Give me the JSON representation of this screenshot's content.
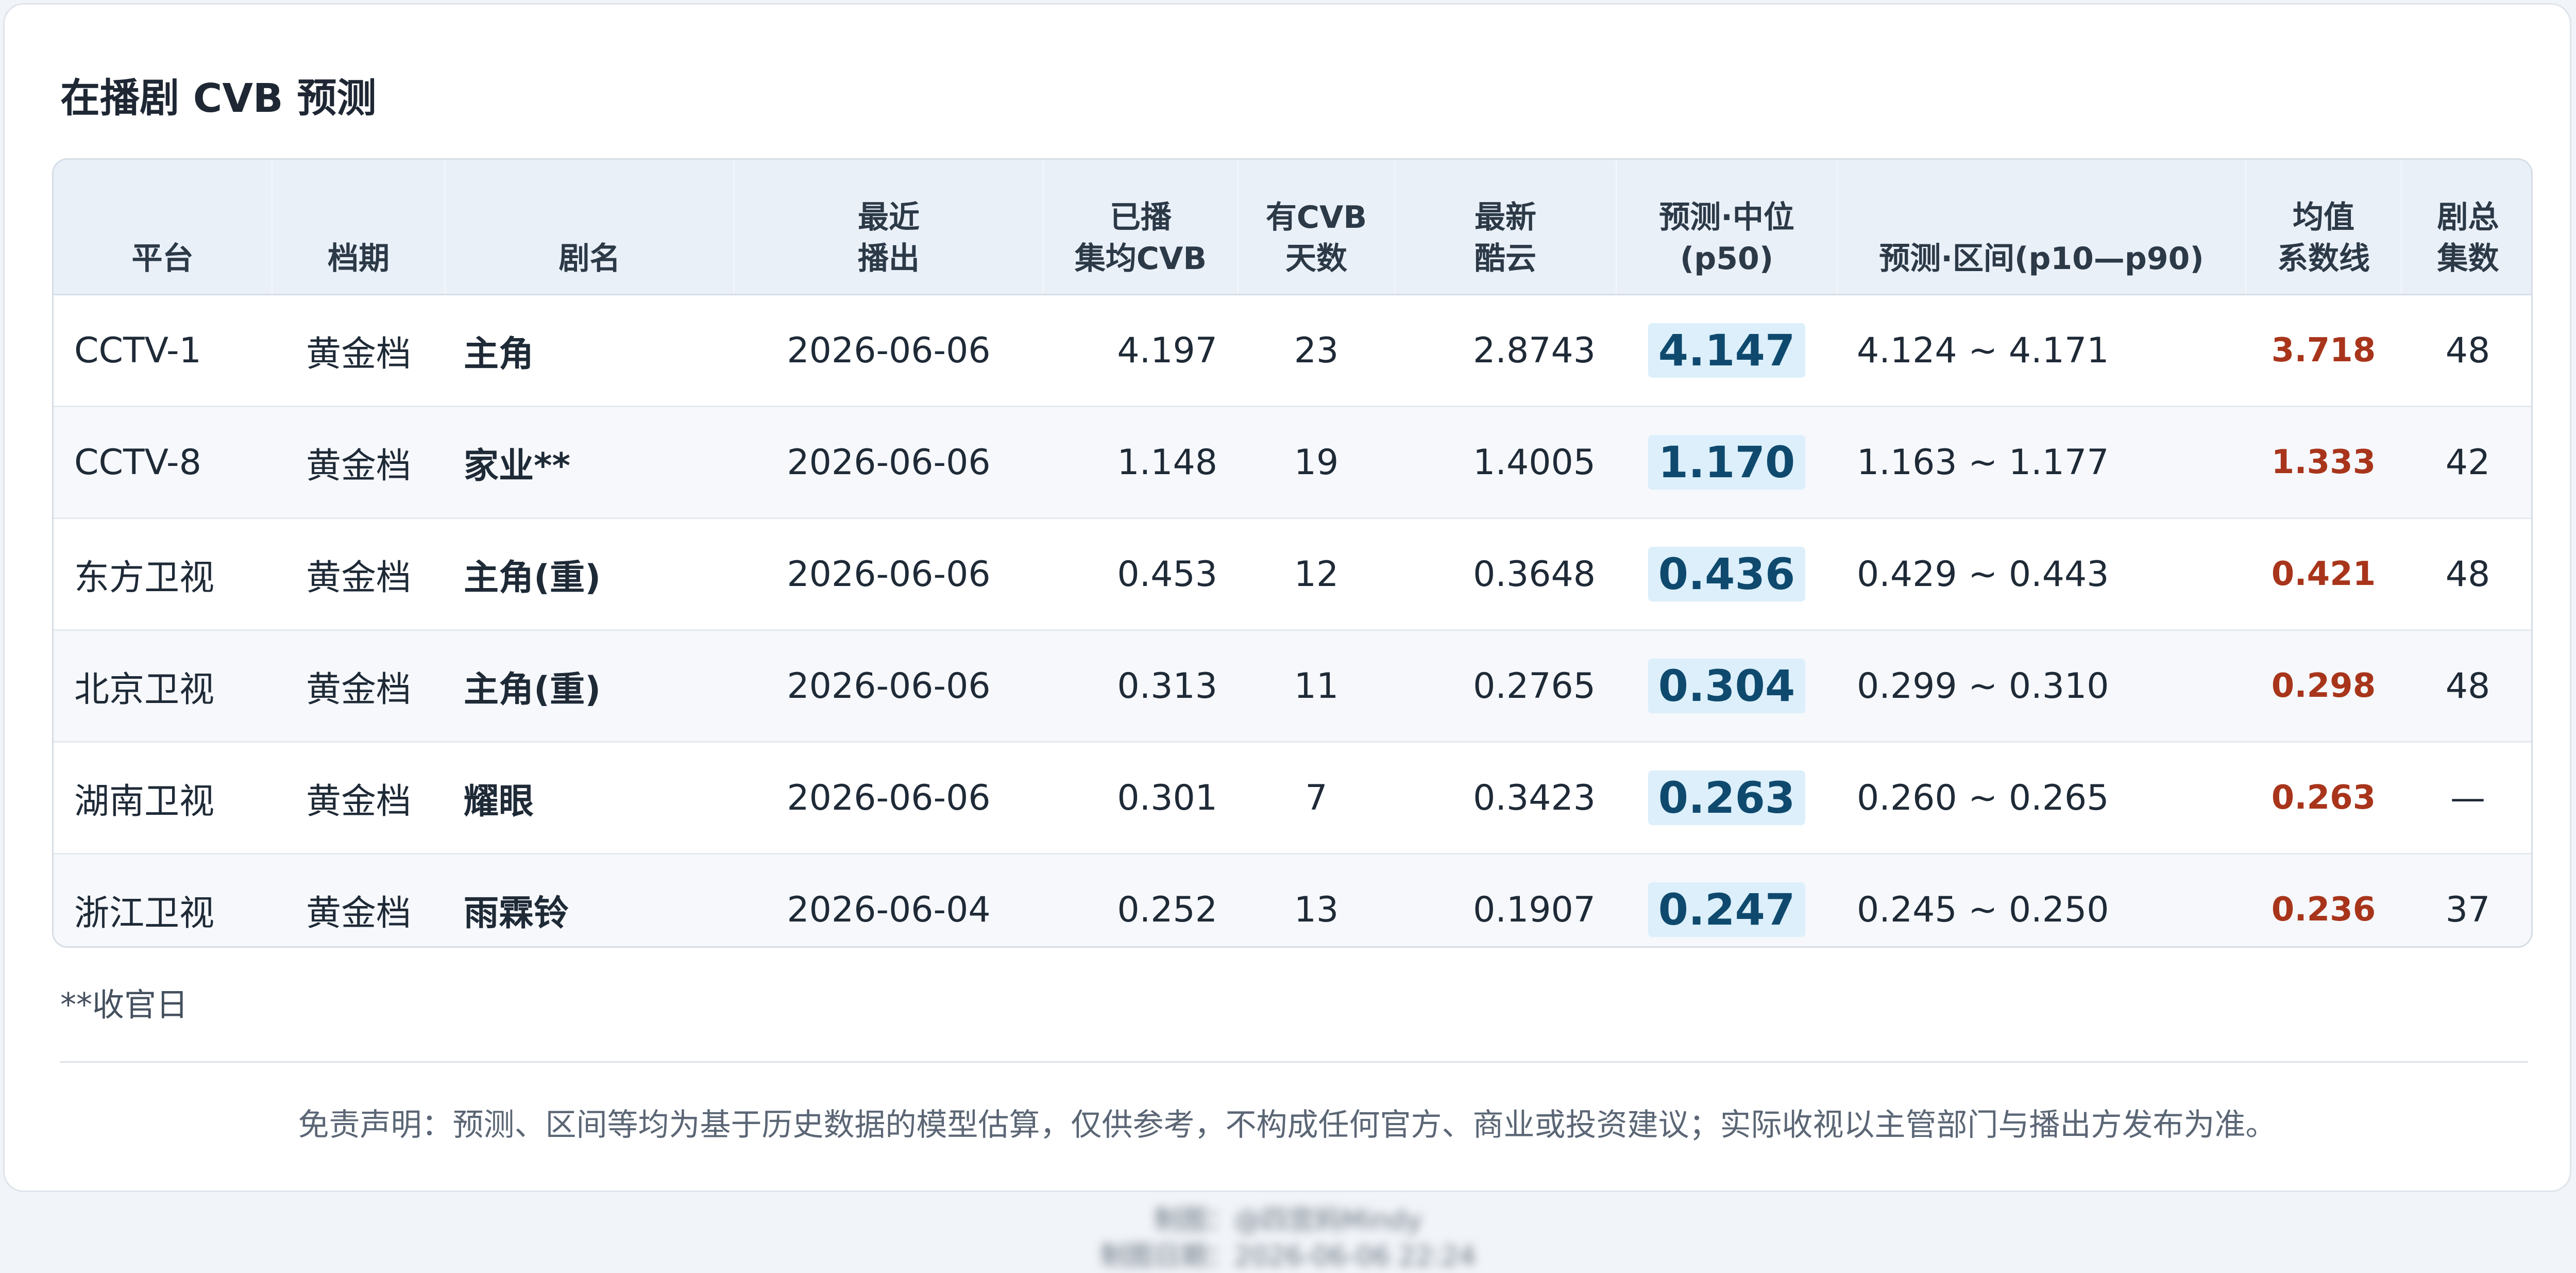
{
  "title": "在播剧 CVB 预测",
  "table": {
    "headers": {
      "platform": [
        "平台"
      ],
      "slot": [
        "档期"
      ],
      "drama": [
        "剧名"
      ],
      "recent_air": [
        "最近",
        "播出"
      ],
      "aired_avg": [
        "已播",
        "集均CVB"
      ],
      "cvb_days": [
        "有CVB",
        "天数"
      ],
      "kuyun": [
        "最新",
        "酷云"
      ],
      "p50": [
        "预测·中位",
        "(p50)"
      ],
      "range": [
        "预测·区间(p10—p90)"
      ],
      "mean_coef": [
        "均值",
        "系数线"
      ],
      "total_eps": [
        "剧总",
        "集数"
      ]
    },
    "rows": [
      {
        "platform": "CCTV-1",
        "slot": "黄金档",
        "drama": "主角",
        "recent_air": "2026-06-06",
        "aired_avg": "4.197",
        "cvb_days": "23",
        "kuyun": "2.8743",
        "p50": "4.147",
        "range": "4.124 ~ 4.171",
        "mean_coef": "3.718",
        "total_eps": "48"
      },
      {
        "platform": "CCTV-8",
        "slot": "黄金档",
        "drama": "家业**",
        "recent_air": "2026-06-06",
        "aired_avg": "1.148",
        "cvb_days": "19",
        "kuyun": "1.4005",
        "p50": "1.170",
        "range": "1.163 ~ 1.177",
        "mean_coef": "1.333",
        "total_eps": "42"
      },
      {
        "platform": "东方卫视",
        "slot": "黄金档",
        "drama": "主角(重)",
        "recent_air": "2026-06-06",
        "aired_avg": "0.453",
        "cvb_days": "12",
        "kuyun": "0.3648",
        "p50": "0.436",
        "range": "0.429 ~ 0.443",
        "mean_coef": "0.421",
        "total_eps": "48"
      },
      {
        "platform": "北京卫视",
        "slot": "黄金档",
        "drama": "主角(重)",
        "recent_air": "2026-06-06",
        "aired_avg": "0.313",
        "cvb_days": "11",
        "kuyun": "0.2765",
        "p50": "0.304",
        "range": "0.299 ~ 0.310",
        "mean_coef": "0.298",
        "total_eps": "48"
      },
      {
        "platform": "湖南卫视",
        "slot": "黄金档",
        "drama": "耀眼",
        "recent_air": "2026-06-06",
        "aired_avg": "0.301",
        "cvb_days": "7",
        "kuyun": "0.3423",
        "p50": "0.263",
        "range": "0.260 ~ 0.265",
        "mean_coef": "0.263",
        "total_eps": "—"
      },
      {
        "platform": "浙江卫视",
        "slot": "黄金档",
        "drama": "雨霖铃",
        "recent_air": "2026-06-04",
        "aired_avg": "0.252",
        "cvb_days": "13",
        "kuyun": "0.1907",
        "p50": "0.247",
        "range": "0.245 ~ 0.250",
        "mean_coef": "0.236",
        "total_eps": "37"
      }
    ]
  },
  "footnote": "**收官日",
  "disclaimer": "免责声明：预测、区间等均为基于历史数据的模型估算，仅供参考，不构成任何官方、商业或投资建议；实际收视以主管部门与播出方发布为准。",
  "credit_lines": [
    "制图：@四宫妈Mindy",
    "制图日期：2026-06-06 22:24"
  ],
  "colors": {
    "header_bg": "#eaf0f8",
    "p50_highlight": "#dceffb",
    "p50_text": "#0f4a6e",
    "mean_text": "#a8351b"
  }
}
